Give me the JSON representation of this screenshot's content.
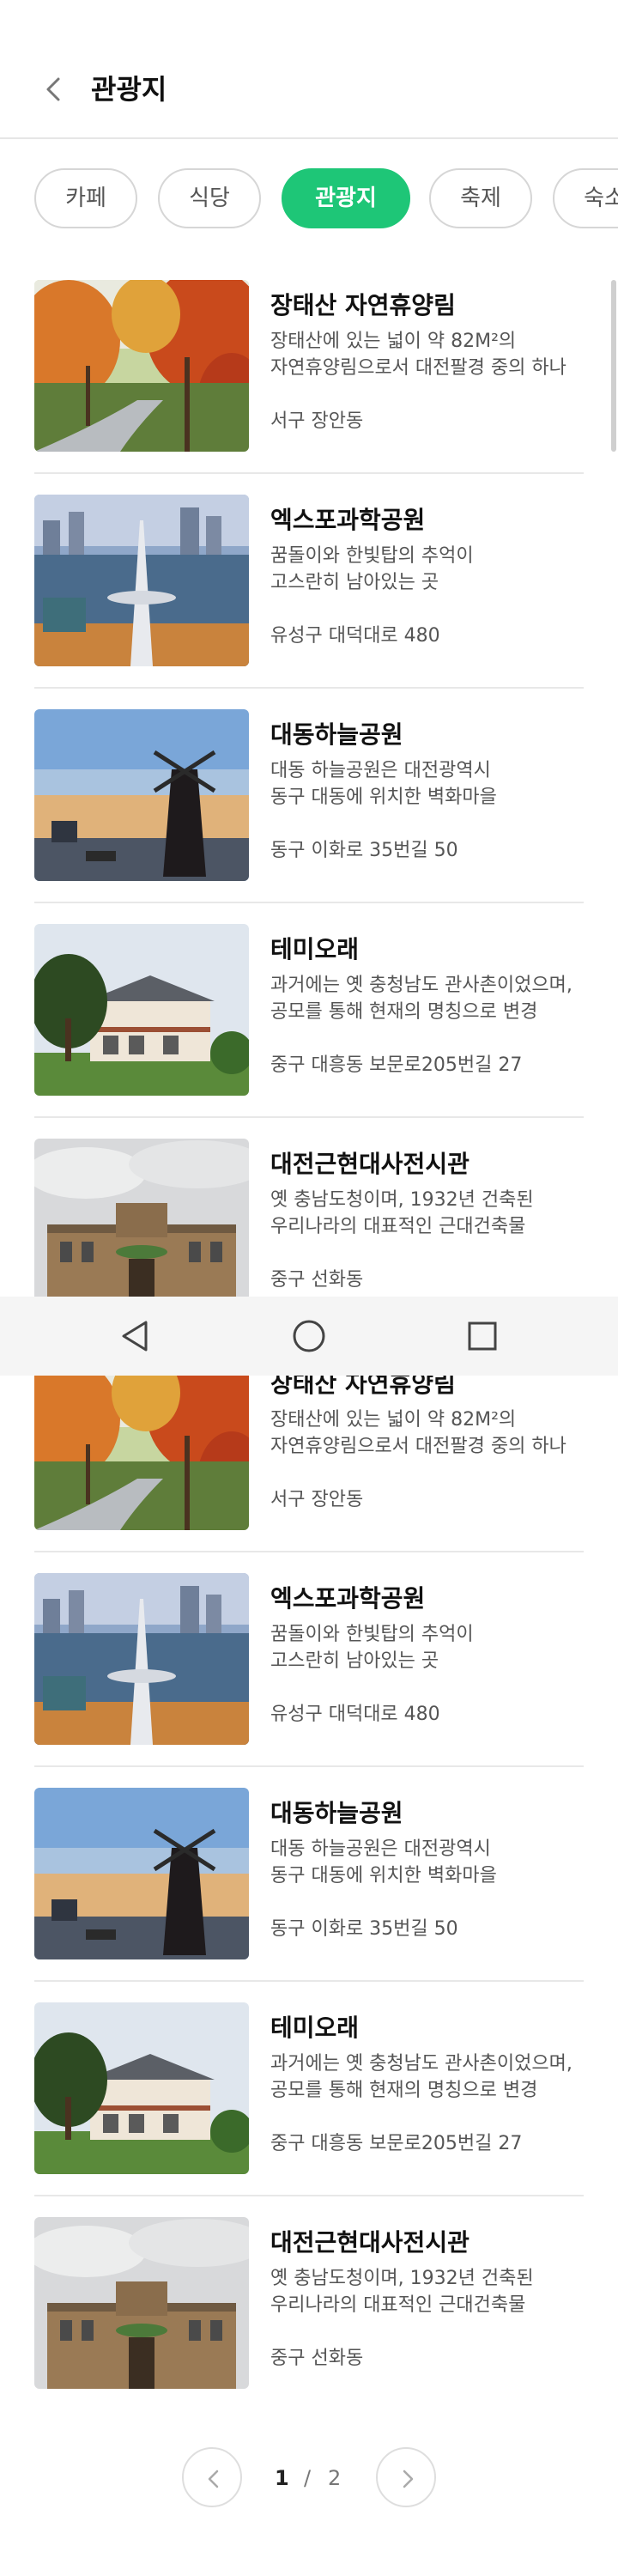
{
  "header": {
    "title": "관광지",
    "back_icon": "chevron-left-icon"
  },
  "categories": [
    {
      "label": "카페",
      "active": false
    },
    {
      "label": "식당",
      "active": false
    },
    {
      "label": "관광지",
      "active": true
    },
    {
      "label": "축제",
      "active": false
    },
    {
      "label": "숙소",
      "active": false
    }
  ],
  "theme": {
    "accent": "#1ec677"
  },
  "places": [
    {
      "name": "장태산 자연휴양림",
      "desc1": "장태산에 있는 넓이 약 82M²의",
      "desc2": "자연휴양림으로서 대전팔경 중의 하나",
      "address": "서구 장안동"
    },
    {
      "name": "엑스포과학공원",
      "desc1": "꿈돌이와 한빛탑의 추억이",
      "desc2": "고스란히 남아있는 곳",
      "address": "유성구 대덕대로 480"
    },
    {
      "name": "대동하늘공원",
      "desc1": "대동 하늘공원은 대전광역시",
      "desc2": "동구 대동에 위치한 벽화마을",
      "address": "동구 이화로 35번길 50"
    },
    {
      "name": "테미오래",
      "desc1": "과거에는 옛 충청남도 관사촌이었으며,",
      "desc2": "공모를 통해 현재의 명칭으로 변경",
      "address": "중구 대흥동 보문로205번길 27"
    },
    {
      "name": "대전근현대사전시관",
      "desc1": "옛 충남도청이며, 1932년 건축된",
      "desc2": "우리나라의 대표적인 근대건축물",
      "address": "중구 선화동"
    }
  ],
  "system_nav": {
    "back_icon": "triangle-back-icon",
    "home_icon": "circle-home-icon",
    "recents_icon": "square-recents-icon"
  },
  "pagination": {
    "current": "1",
    "separator": "/",
    "total": "2",
    "prev_icon": "chevron-left-icon",
    "next_icon": "chevron-right-icon"
  }
}
